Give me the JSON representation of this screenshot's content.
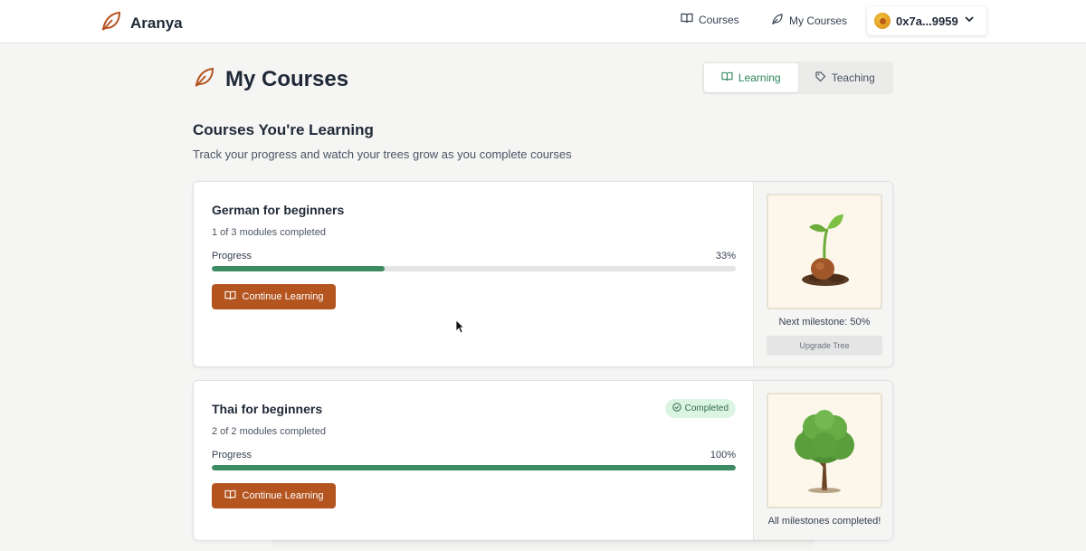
{
  "brand": {
    "name": "Aranya",
    "icon": "leaf-icon"
  },
  "nav": {
    "courses_label": "Courses",
    "my_courses_label": "My Courses",
    "wallet_address": "0x7a...9959"
  },
  "header": {
    "title": "My Courses",
    "tabs": [
      {
        "label": "Learning",
        "active": true,
        "icon": "book-open-icon"
      },
      {
        "label": "Teaching",
        "active": false,
        "icon": "tag-pen-icon"
      }
    ]
  },
  "section": {
    "title": "Courses You're Learning",
    "subtitle": "Track your progress and watch your trees grow as you complete courses"
  },
  "courses": [
    {
      "title": "German for beginners",
      "modules_text": "1 of 3 modules completed",
      "progress_label": "Progress",
      "progress_text": "33%",
      "progress": 0.33,
      "button_label": "Continue Learning",
      "tree_stage": "sprout",
      "milestone_text": "Next milestone: 50%",
      "upgrade_label": "Upgrade Tree"
    },
    {
      "title": "Thai for beginners",
      "badge": "Completed",
      "modules_text": "2 of 2 modules completed",
      "progress_label": "Progress",
      "progress_text": "100%",
      "progress": 1.0,
      "button_label": "Continue Learning",
      "tree_stage": "full-tree",
      "milestone_text": "All milestones completed!"
    }
  ],
  "colors": {
    "accent_brown": "#b4541f",
    "progress_green": "#3d8b63",
    "active_tab_green": "#2f855a",
    "badge_bg": "#dcf5e3"
  }
}
